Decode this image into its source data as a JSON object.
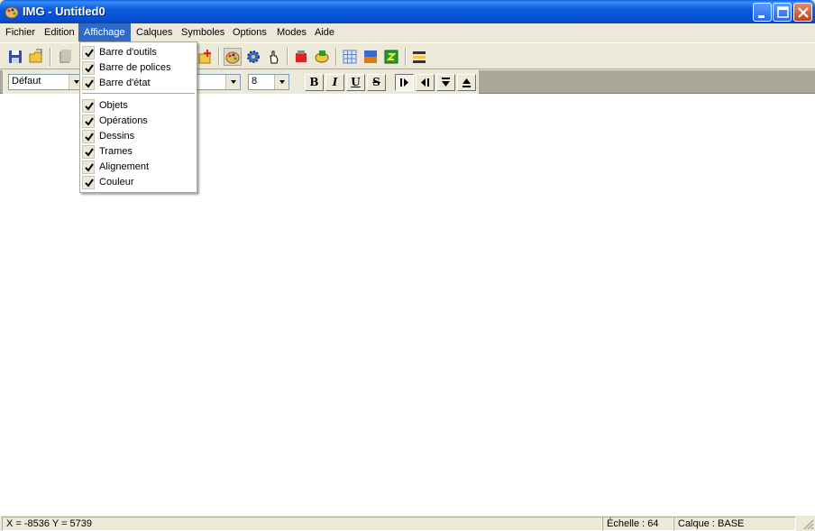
{
  "window": {
    "title": "IMG - Untitled0",
    "icon": "palette-icon"
  },
  "menubar": {
    "items": [
      "Fichier",
      "Edition",
      "Affichage",
      "Calques",
      "Symboles",
      "Options",
      "Modes",
      "Aide"
    ],
    "active": "Affichage"
  },
  "toolbar": {
    "icons": [
      "save-icon",
      "open-icon",
      "copy-icon",
      "symbol-add-icon",
      "palette-icon",
      "gear-icon",
      "hand-icon",
      "layers-red-icon",
      "layers-green-icon",
      "grid-icon",
      "color-square-icon",
      "refresh-icon",
      "list-icon"
    ]
  },
  "fontbar": {
    "style_value": "Défaut",
    "size_value": "8",
    "bold": "B",
    "italic": "I",
    "underline": "U",
    "strike": "S",
    "align_icons": [
      "align-right-icon",
      "align-left-icon",
      "align-bottom-icon",
      "align-top-icon"
    ]
  },
  "dropdown": {
    "group1": [
      {
        "label": "Barre d'outils",
        "checked": true
      },
      {
        "label": "Barre de polices",
        "checked": true
      },
      {
        "label": "Barre d'état",
        "checked": true
      }
    ],
    "group2": [
      {
        "label": "Objets",
        "checked": true
      },
      {
        "label": "Opérations",
        "checked": true
      },
      {
        "label": "Dessins",
        "checked": true
      },
      {
        "label": "Trames",
        "checked": true
      },
      {
        "label": "Alignement",
        "checked": true
      },
      {
        "label": "Couleur",
        "checked": true
      }
    ]
  },
  "statusbar": {
    "coords": "X = -8536  Y = 5739",
    "scale": "Échelle :  64",
    "layer": "Calque :  BASE"
  }
}
